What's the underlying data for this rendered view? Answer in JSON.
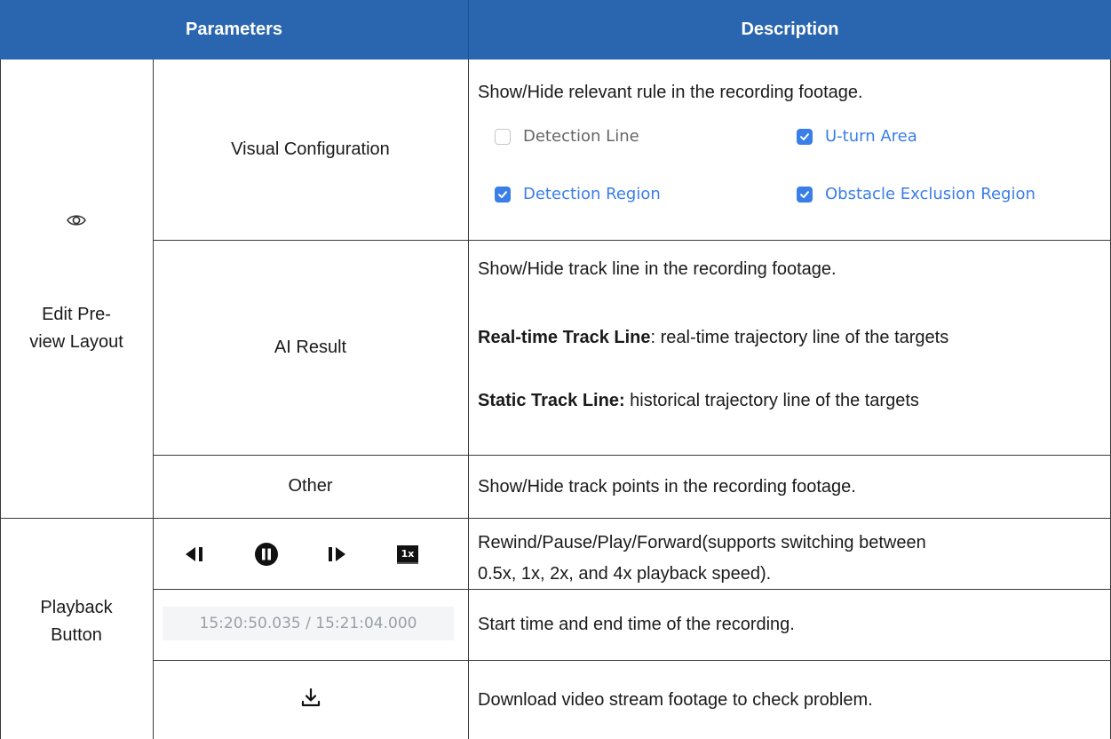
{
  "header": {
    "parameters": "Parameters",
    "description": "Description"
  },
  "edit_preview": {
    "group_label": "Edit Pre-\nview Layout",
    "icon": "eye-icon",
    "visual_configuration": {
      "label": "Visual Configuration",
      "description": "Show/Hide relevant rule in the recording footage.",
      "options": [
        {
          "label": "Detection Line",
          "checked": false
        },
        {
          "label": "U-turn Area",
          "checked": true
        },
        {
          "label": "Detection Region",
          "checked": true
        },
        {
          "label": "Obstacle Exclusion Region",
          "checked": true
        }
      ]
    },
    "ai_result": {
      "label": "AI Result",
      "description": "Show/Hide track line in the recording footage.",
      "realtime_bold": "Real-time Track Line",
      "realtime_text": ": real-time trajectory line of the targets",
      "static_bold": "Static Track Line:",
      "static_text": " historical trajectory line of the targets"
    },
    "other": {
      "label": "Other",
      "description": "Show/Hide track points in the recording footage."
    }
  },
  "playback": {
    "group_label": "Playback\nButton",
    "controls": {
      "icons": [
        "rewind-icon",
        "pause-icon",
        "play-icon",
        "speed-1x-icon"
      ],
      "speed_label": "1x",
      "description_line1": "Rewind/Pause/Play/Forward(supports switching between",
      "description_line2": "0.5x, 1x, 2x, and 4x playback speed)."
    },
    "time": {
      "value": "15:20:50.035 / 15:21:04.000",
      "description": "Start time and end time of the recording."
    },
    "download": {
      "icon": "download-icon",
      "description": "Download video stream footage to check problem."
    }
  },
  "colors": {
    "header_bg": "#2a66b0",
    "accent": "#3a7ee8"
  }
}
